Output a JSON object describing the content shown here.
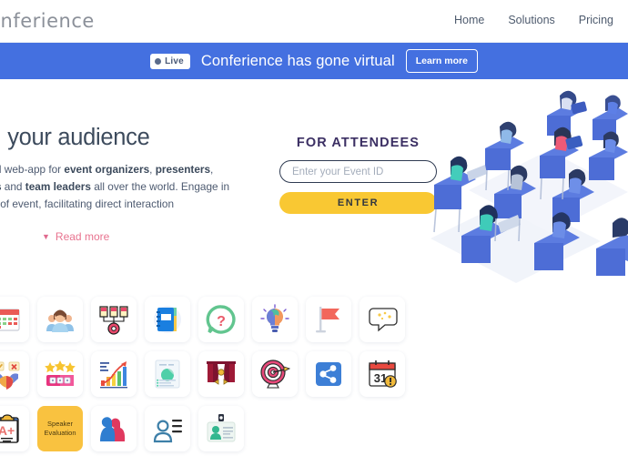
{
  "header": {
    "logo_text": "Conferience",
    "nav": [
      {
        "label": "Home"
      },
      {
        "label": "Solutions"
      },
      {
        "label": "Pricing"
      }
    ]
  },
  "banner": {
    "badge_label": "Live",
    "message": "Conferience has gone virtual",
    "cta_label": "Learn more",
    "background_color": "#4470e0"
  },
  "hero": {
    "title": "Feel your audience",
    "paragraph_html": "The ideal web-app for <b>event organizers</b>, <b>presenters</b>, <b>teachers</b> and <b>team leaders</b> all over the world. Engage in any kind of event, facilitating direct interaction",
    "read_more_label": "Read more",
    "read_more_color": "#e8738f"
  },
  "attendees": {
    "heading": "FOR ATTENDEES",
    "input_placeholder": "Enter your Event ID",
    "input_value": "",
    "submit_label": "ENTER",
    "submit_color": "#f9c833"
  },
  "feature_tiles": [
    {
      "icon": "calendar-schedule-icon",
      "label": ""
    },
    {
      "icon": "audience-people-icon",
      "label": ""
    },
    {
      "icon": "live-polls-gear-icon",
      "label": ""
    },
    {
      "icon": "notebook-agenda-icon",
      "label": ""
    },
    {
      "icon": "question-mark-icon",
      "label": ""
    },
    {
      "icon": "idea-lightbulb-brain-icon",
      "label": ""
    },
    {
      "icon": "red-flag-icon",
      "label": ""
    },
    {
      "icon": "speech-bubble-sparkle-icon",
      "label": ""
    },
    {
      "icon": "decision-vote-handshake-icon",
      "label": ""
    },
    {
      "icon": "star-rating-icon",
      "label": ""
    },
    {
      "icon": "growth-chart-icon",
      "label": ""
    },
    {
      "icon": "analytics-report-icon",
      "label": ""
    },
    {
      "icon": "stage-curtains-icon",
      "label": ""
    },
    {
      "icon": "target-dartboard-icon",
      "label": ""
    },
    {
      "icon": "share-network-icon",
      "label": ""
    },
    {
      "icon": "calendar-alert-31-icon",
      "label": "31"
    },
    {
      "icon": "grade-clipboard-a-plus-icon",
      "label": "A+"
    },
    {
      "icon": "speaker-evaluation-tile",
      "label": "Speaker Evaluation"
    },
    {
      "icon": "two-profiles-icon",
      "label": ""
    },
    {
      "icon": "profile-list-icon",
      "label": ""
    },
    {
      "icon": "id-badge-card-icon",
      "label": ""
    }
  ]
}
